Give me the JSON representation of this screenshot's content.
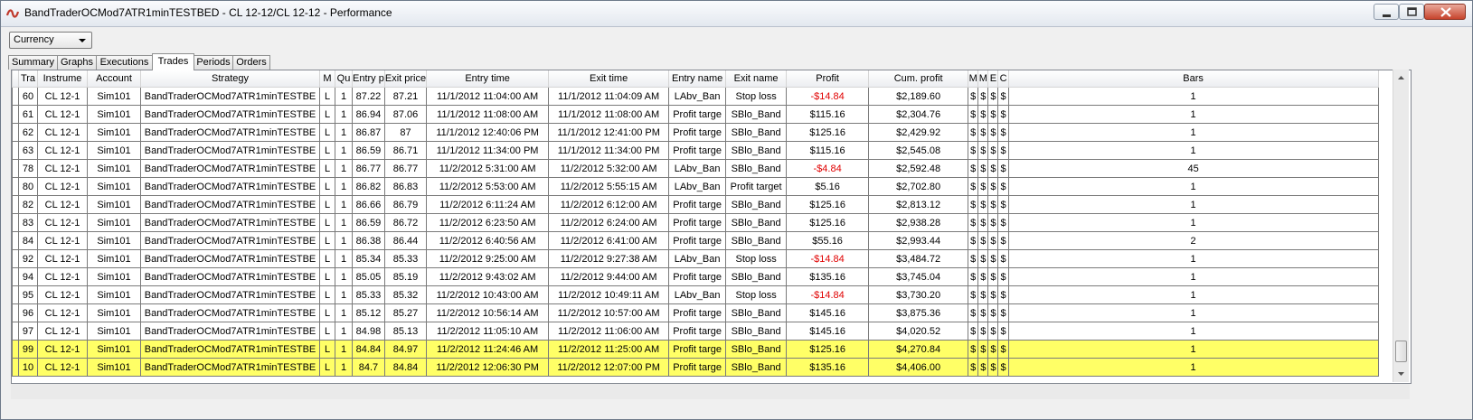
{
  "window": {
    "title": "BandTraderOCMod7ATR1minTESTBED - CL 12-12/CL 12-12 - Performance",
    "icon": "app-logo-icon"
  },
  "display_select": {
    "value": "Currency"
  },
  "tabs": [
    {
      "label": "Summary"
    },
    {
      "label": "Graphs"
    },
    {
      "label": "Executions"
    },
    {
      "label": "Trades",
      "active": true
    },
    {
      "label": "Periods"
    },
    {
      "label": "Orders"
    }
  ],
  "columns": [
    "Tra",
    "Instrume",
    "Account",
    "Strategy",
    "M",
    "Qu",
    "Entry p",
    "Exit price",
    "Entry time",
    "Exit time",
    "Entry name",
    "Exit name",
    "Profit",
    "Cum. profit",
    "M",
    "M",
    "E",
    "C",
    "Bars"
  ],
  "rows": [
    [
      "60",
      "CL 12-1",
      "Sim101",
      "BandTraderOCMod7ATR1minTESTBE",
      "L",
      "1",
      "87.22",
      "87.21",
      "11/1/2012 11:04:00 AM",
      "11/1/2012 11:04:09 AM",
      "LAbv_Ban",
      "Stop loss",
      "-$14.84",
      "$2,189.60",
      "$",
      "$",
      "$",
      "$",
      "1"
    ],
    [
      "61",
      "CL 12-1",
      "Sim101",
      "BandTraderOCMod7ATR1minTESTBE",
      "L",
      "1",
      "86.94",
      "87.06",
      "11/1/2012 11:08:00 AM",
      "11/1/2012 11:08:00 AM",
      "Profit targe",
      "SBlo_Band",
      "$115.16",
      "$2,304.76",
      "$",
      "$",
      "$",
      "$",
      "1"
    ],
    [
      "62",
      "CL 12-1",
      "Sim101",
      "BandTraderOCMod7ATR1minTESTBE",
      "L",
      "1",
      "86.87",
      "87",
      "11/1/2012 12:40:06 PM",
      "11/1/2012 12:41:00 PM",
      "Profit targe",
      "SBlo_Band",
      "$125.16",
      "$2,429.92",
      "$",
      "$",
      "$",
      "$",
      "1"
    ],
    [
      "63",
      "CL 12-1",
      "Sim101",
      "BandTraderOCMod7ATR1minTESTBE",
      "L",
      "1",
      "86.59",
      "86.71",
      "11/1/2012 11:34:00 PM",
      "11/1/2012 11:34:00 PM",
      "Profit targe",
      "SBlo_Band",
      "$115.16",
      "$2,545.08",
      "$",
      "$",
      "$",
      "$",
      "1"
    ],
    [
      "78",
      "CL 12-1",
      "Sim101",
      "BandTraderOCMod7ATR1minTESTBE",
      "L",
      "1",
      "86.77",
      "86.77",
      "11/2/2012 5:31:00 AM",
      "11/2/2012 5:32:00 AM",
      "LAbv_Ban",
      "SBlo_Band",
      "-$4.84",
      "$2,592.48",
      "$",
      "$",
      "$",
      "$",
      "45"
    ],
    [
      "80",
      "CL 12-1",
      "Sim101",
      "BandTraderOCMod7ATR1minTESTBE",
      "L",
      "1",
      "86.82",
      "86.83",
      "11/2/2012 5:53:00 AM",
      "11/2/2012 5:55:15 AM",
      "LAbv_Ban",
      "Profit target",
      "$5.16",
      "$2,702.80",
      "$",
      "$",
      "$",
      "$",
      "1"
    ],
    [
      "82",
      "CL 12-1",
      "Sim101",
      "BandTraderOCMod7ATR1minTESTBE",
      "L",
      "1",
      "86.66",
      "86.79",
      "11/2/2012 6:11:24 AM",
      "11/2/2012 6:12:00 AM",
      "Profit targe",
      "SBlo_Band",
      "$125.16",
      "$2,813.12",
      "$",
      "$",
      "$",
      "$",
      "1"
    ],
    [
      "83",
      "CL 12-1",
      "Sim101",
      "BandTraderOCMod7ATR1minTESTBE",
      "L",
      "1",
      "86.59",
      "86.72",
      "11/2/2012 6:23:50 AM",
      "11/2/2012 6:24:00 AM",
      "Profit targe",
      "SBlo_Band",
      "$125.16",
      "$2,938.28",
      "$",
      "$",
      "$",
      "$",
      "1"
    ],
    [
      "84",
      "CL 12-1",
      "Sim101",
      "BandTraderOCMod7ATR1minTESTBE",
      "L",
      "1",
      "86.38",
      "86.44",
      "11/2/2012 6:40:56 AM",
      "11/2/2012 6:41:00 AM",
      "Profit targe",
      "SBlo_Band",
      "$55.16",
      "$2,993.44",
      "$",
      "$",
      "$",
      "$",
      "2"
    ],
    [
      "92",
      "CL 12-1",
      "Sim101",
      "BandTraderOCMod7ATR1minTESTBE",
      "L",
      "1",
      "85.34",
      "85.33",
      "11/2/2012 9:25:00 AM",
      "11/2/2012 9:27:38 AM",
      "LAbv_Ban",
      "Stop loss",
      "-$14.84",
      "$3,484.72",
      "$",
      "$",
      "$",
      "$",
      "1"
    ],
    [
      "94",
      "CL 12-1",
      "Sim101",
      "BandTraderOCMod7ATR1minTESTBE",
      "L",
      "1",
      "85.05",
      "85.19",
      "11/2/2012 9:43:02 AM",
      "11/2/2012 9:44:00 AM",
      "Profit targe",
      "SBlo_Band",
      "$135.16",
      "$3,745.04",
      "$",
      "$",
      "$",
      "$",
      "1"
    ],
    [
      "95",
      "CL 12-1",
      "Sim101",
      "BandTraderOCMod7ATR1minTESTBE",
      "L",
      "1",
      "85.33",
      "85.32",
      "11/2/2012 10:43:00 AM",
      "11/2/2012 10:49:11 AM",
      "LAbv_Ban",
      "Stop loss",
      "-$14.84",
      "$3,730.20",
      "$",
      "$",
      "$",
      "$",
      "1"
    ],
    [
      "96",
      "CL 12-1",
      "Sim101",
      "BandTraderOCMod7ATR1minTESTBE",
      "L",
      "1",
      "85.12",
      "85.27",
      "11/2/2012 10:56:14 AM",
      "11/2/2012 10:57:00 AM",
      "Profit targe",
      "SBlo_Band",
      "$145.16",
      "$3,875.36",
      "$",
      "$",
      "$",
      "$",
      "1"
    ],
    [
      "97",
      "CL 12-1",
      "Sim101",
      "BandTraderOCMod7ATR1minTESTBE",
      "L",
      "1",
      "84.98",
      "85.13",
      "11/2/2012 11:05:10 AM",
      "11/2/2012 11:06:00 AM",
      "Profit targe",
      "SBlo_Band",
      "$145.16",
      "$4,020.52",
      "$",
      "$",
      "$",
      "$",
      "1"
    ],
    [
      "99",
      "CL 12-1",
      "Sim101",
      "BandTraderOCMod7ATR1minTESTBE",
      "L",
      "1",
      "84.84",
      "84.97",
      "11/2/2012 11:24:46 AM",
      "11/2/2012 11:25:00 AM",
      "Profit targe",
      "SBlo_Band",
      "$125.16",
      "$4,270.84",
      "$",
      "$",
      "$",
      "$",
      "1"
    ],
    [
      "10",
      "CL 12-1",
      "Sim101",
      "BandTraderOCMod7ATR1minTESTBE",
      "L",
      "1",
      "84.7",
      "84.84",
      "11/2/2012 12:06:30 PM",
      "11/2/2012 12:07:00 PM",
      "Profit targe",
      "SBlo_Band",
      "$135.16",
      "$4,406.00",
      "$",
      "$",
      "$",
      "$",
      "1"
    ]
  ],
  "highlighted_rows": [
    14,
    15
  ],
  "colors": {
    "highlight": "#ffff66",
    "negative": "#e00000"
  }
}
